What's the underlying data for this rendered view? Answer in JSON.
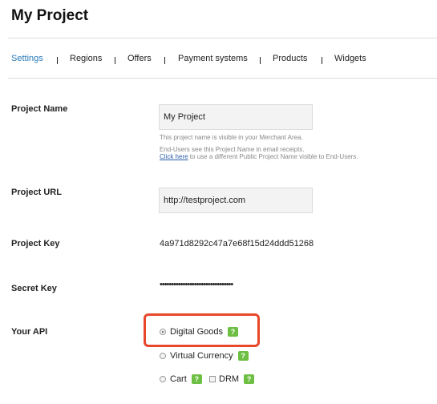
{
  "page": {
    "title": "My Project"
  },
  "tabs": [
    {
      "label": "Settings",
      "active": true
    },
    {
      "label": "Regions"
    },
    {
      "label": "Offers"
    },
    {
      "label": "Payment systems"
    },
    {
      "label": "Products"
    },
    {
      "label": "Widgets"
    }
  ],
  "project_name": {
    "label": "Project Name",
    "value": "My Project",
    "help_line1": "This project name is visible in your Merchant Area.",
    "help_line2": "End-Users see this Project Name in email receipts.",
    "help_link": "Click here",
    "help_line3_rest": " to use a different Public Project Name visible to End-Users."
  },
  "project_url": {
    "label": "Project URL",
    "value": "http://testproject.com"
  },
  "project_key": {
    "label": "Project Key",
    "value": "4a971d8292c47a7e68f15d24ddd51268"
  },
  "secret_key": {
    "label": "Secret Key",
    "value": "••••••••••••••••••••••••••••••••"
  },
  "api": {
    "label": "Your API",
    "options": {
      "digital_goods": {
        "label": "Digital Goods",
        "checked": true
      },
      "virtual_currency": {
        "label": "Virtual Currency",
        "checked": false
      },
      "cart": {
        "label": "Cart",
        "checked": false
      },
      "drm": {
        "label": "DRM",
        "checked": false
      }
    },
    "help_glyph": "?"
  },
  "colors": {
    "accent": "#2b7bb9",
    "help_badge": "#6cbf42",
    "highlight": "#e8472b"
  }
}
